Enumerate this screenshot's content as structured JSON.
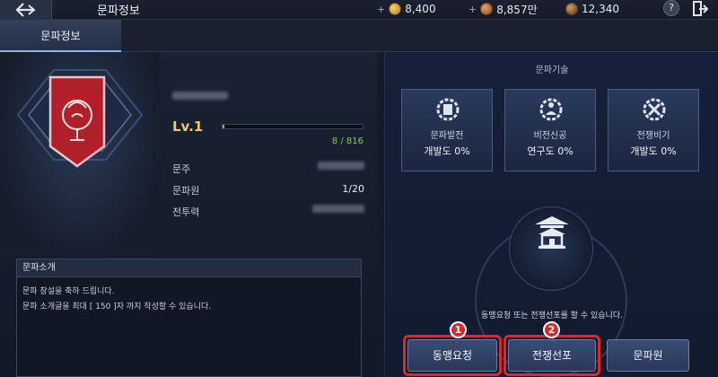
{
  "header": {
    "title": "문파정보",
    "currencies": [
      {
        "icon": "gold-coin-icon",
        "amount": "8,400"
      },
      {
        "icon": "bronze-coin-icon",
        "amount": "8,857만"
      },
      {
        "icon": "guild-coin-icon",
        "amount": "12,340"
      }
    ],
    "help_label": "?",
    "plus_symbol": "+"
  },
  "tabs": [
    {
      "label": "문파정보"
    }
  ],
  "guild": {
    "name": "",
    "level": "Lv.1",
    "exp_text": "8 / 816",
    "exp_fraction": 0.0098,
    "info": [
      {
        "label": "문주",
        "value": ""
      },
      {
        "label": "문파원",
        "value": "1/20"
      },
      {
        "label": "전투력",
        "value": ""
      }
    ]
  },
  "introduction": {
    "title": "문파소개",
    "lines": [
      "문파 창설을 축하 드립니다.",
      "문파 소개글을 최대 [ 150 ]자 까지 작성할 수 있습니다."
    ]
  },
  "techniques": {
    "title": "문파기술",
    "items": [
      {
        "name": "문파발전",
        "progress": "개발도 0%",
        "icon": "development-gear-icon"
      },
      {
        "name": "비전신공",
        "progress": "연구도 0%",
        "icon": "meditation-gear-icon"
      },
      {
        "name": "전쟁비기",
        "progress": "개발도 0%",
        "icon": "war-tools-gear-icon"
      }
    ]
  },
  "notice": "동맹요청 또는 전쟁선포를 할 수 있습니다.",
  "actions": [
    {
      "label": "동맹요청",
      "marker": "1"
    },
    {
      "label": "전쟁선포",
      "marker": "2"
    },
    {
      "label": "문파원"
    }
  ],
  "colors": {
    "accent_red": "#e0262a",
    "level_gold": "#f0c76a",
    "exp_green": "#7fcf5a",
    "emblem_red": "#b1202a"
  }
}
